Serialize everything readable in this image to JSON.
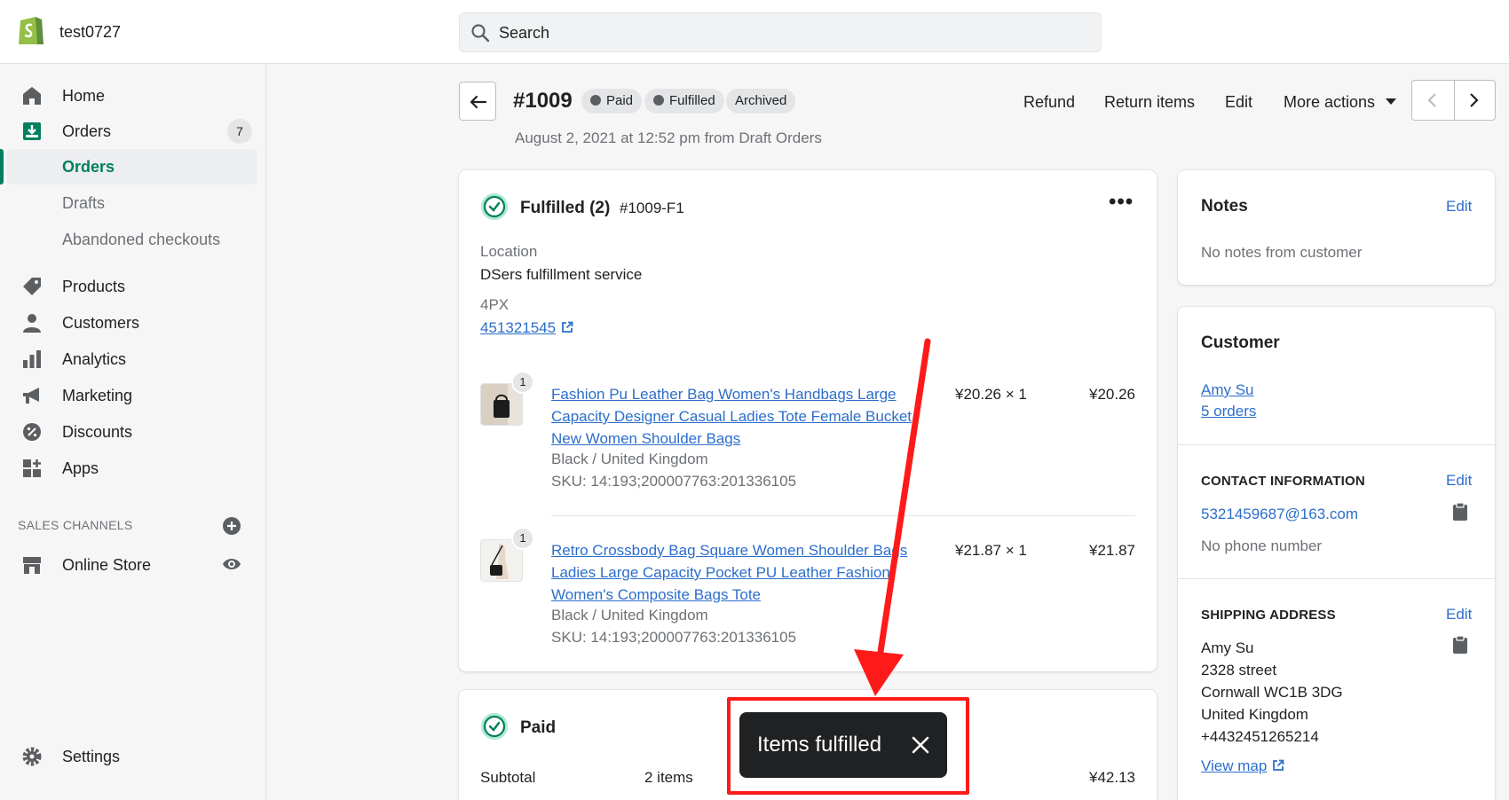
{
  "topbar": {
    "store_name": "test0727",
    "search_placeholder": "Search"
  },
  "sidebar": {
    "items": [
      {
        "label": "Home",
        "icon": "home-icon"
      },
      {
        "label": "Orders",
        "icon": "orders-icon",
        "badge": "7"
      },
      {
        "label": "Orders",
        "sub": true,
        "active": true
      },
      {
        "label": "Drafts",
        "sub": true
      },
      {
        "label": "Abandoned checkouts",
        "sub": true
      },
      {
        "label": "Products",
        "icon": "tag-icon"
      },
      {
        "label": "Customers",
        "icon": "person-icon"
      },
      {
        "label": "Analytics",
        "icon": "bar-chart-icon"
      },
      {
        "label": "Marketing",
        "icon": "megaphone-icon"
      },
      {
        "label": "Discounts",
        "icon": "discount-icon"
      },
      {
        "label": "Apps",
        "icon": "apps-icon"
      }
    ],
    "sales_channels_label": "SALES CHANNELS",
    "online_store_label": "Online Store",
    "settings_label": "Settings"
  },
  "order": {
    "id": "#1009",
    "badges": [
      "Paid",
      "Fulfilled",
      "Archived"
    ],
    "date_line": "August 2, 2021 at 12:52 pm from Draft Orders",
    "actions": {
      "refund": "Refund",
      "return_items": "Return items",
      "edit": "Edit",
      "more_actions": "More actions"
    }
  },
  "fulfilled_card": {
    "title": "Fulfilled (2)",
    "ref": "#1009-F1",
    "location_label": "Location",
    "location_value": "DSers fulfillment service",
    "carrier": "4PX",
    "tracking": "451321545",
    "items": [
      {
        "qty_badge": "1",
        "title_lines": [
          "Fashion Pu Leather Bag Women's Handbags Large",
          "Capacity Designer Casual Ladies Tote Female Bucket",
          "New Women Shoulder Bags"
        ],
        "variant": "Black / United Kingdom",
        "sku": "SKU: 14:193;200007763:201336105",
        "price_qty": "¥20.26 × 1",
        "total": "¥20.26"
      },
      {
        "qty_badge": "1",
        "title_lines": [
          "Retro Crossbody Bag Square Women Shoulder Bags",
          "Ladies Large Capacity Pocket PU Leather Fashion",
          "Women's Composite Bags Tote"
        ],
        "variant": "Black / United Kingdom",
        "sku": "SKU: 14:193;200007763:201336105",
        "price_qty": "¥21.87 × 1",
        "total": "¥21.87"
      }
    ]
  },
  "paid_card": {
    "title": "Paid",
    "subtotal_label": "Subtotal",
    "subtotal_items": "2 items",
    "subtotal_value": "¥42.13"
  },
  "notes_card": {
    "title": "Notes",
    "edit": "Edit",
    "text": "No notes from customer"
  },
  "customer_card": {
    "title": "Customer",
    "name": "Amy Su",
    "orders": "5 orders",
    "contact_label": "CONTACT INFORMATION",
    "contact_edit": "Edit",
    "email": "5321459687@163.com",
    "phone": "No phone number",
    "shipping_label": "SHIPPING ADDRESS",
    "shipping_edit": "Edit",
    "address_lines": [
      "Amy Su",
      "2328 street",
      "Cornwall WC1B 3DG",
      "United Kingdom",
      "+4432451265214"
    ],
    "view_map": "View map"
  },
  "toast": {
    "text": "Items fulfilled"
  },
  "colors": {
    "brand_green": "#008060",
    "link_blue": "#2c6ecb",
    "annotation_red": "#ff1a1a"
  }
}
